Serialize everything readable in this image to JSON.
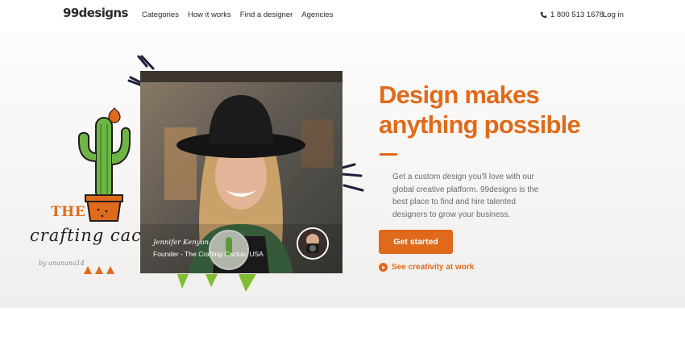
{
  "header": {
    "logo": "99designs",
    "nav": [
      "Categories",
      "How it works",
      "Find a designer",
      "Agencies"
    ],
    "phone": "1 800 513 1678",
    "login": "Log in"
  },
  "hero": {
    "headline_line1": "Design makes",
    "headline_line2": "anything possible",
    "description": "Get a custom design you'll love with our global creative platform. 99designs is the best place to find and hire talented designers to grow your business.",
    "cta_label": "Get started",
    "video_link": "See creativity at work",
    "testimonial": {
      "name": "Jennifer Kenyon",
      "role": "Founder - The Crafting Cactus, USA"
    },
    "illustration": {
      "brand_the": "THE",
      "brand_script": "crafting cactus",
      "byline": "by ananana14"
    }
  },
  "colors": {
    "accent": "#e06a1b",
    "text": "#2b2b2b",
    "muted": "#6b6b6b"
  }
}
